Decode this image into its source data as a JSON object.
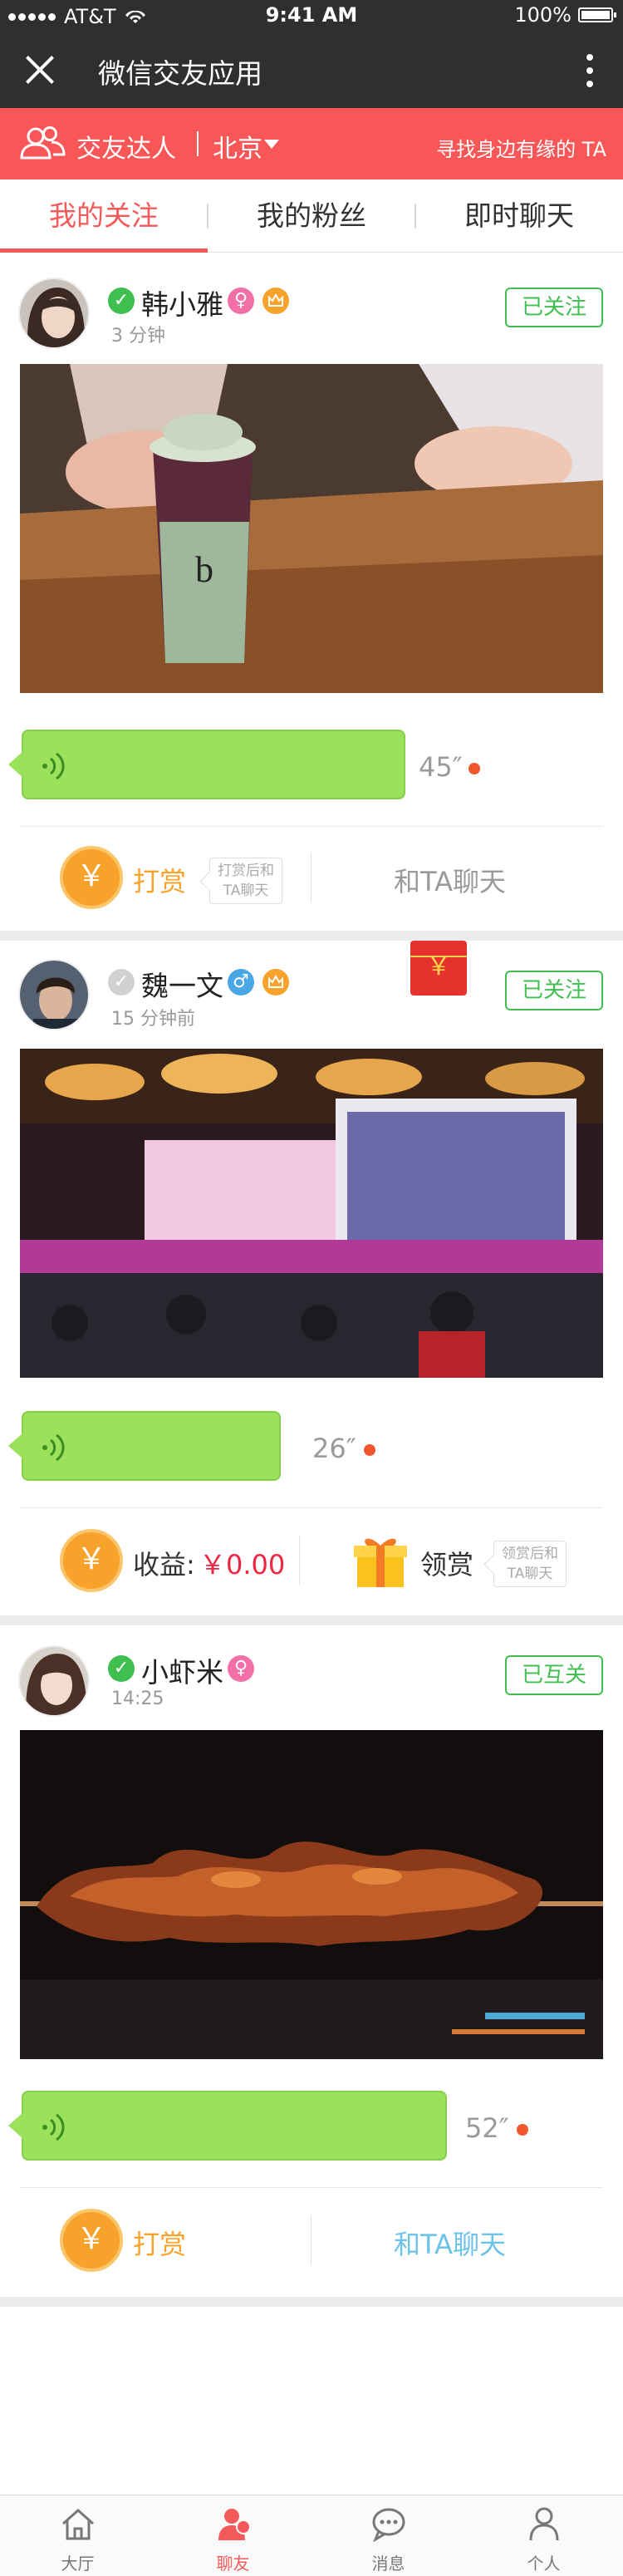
{
  "status_bar": {
    "carrier": "AT&T",
    "time": "9:41 AM",
    "battery": "100%"
  },
  "nav": {
    "title": "微信交友应用"
  },
  "banner": {
    "category": "交友达人",
    "city": "北京",
    "hint": "寻找身边有缘的 TA"
  },
  "tabs": [
    {
      "label": "我的关注"
    },
    {
      "label": "我的粉丝"
    },
    {
      "label": "即时聊天"
    }
  ],
  "posts": [
    {
      "name": "韩小雅",
      "time": "3 分钟",
      "follow_label": "已关注",
      "voice_duration": "45″",
      "reward_label": "打赏",
      "reward_hint": [
        "打赏后和",
        "TA聊天"
      ],
      "chat_label": "和TA聊天"
    },
    {
      "name": "魏一文",
      "time": "15 分钟前",
      "follow_label": "已关注",
      "voice_duration": "26″",
      "income_label": "收益:",
      "income_value": "￥0.00",
      "claim_label": "领赏",
      "claim_hint": [
        "领赏后和",
        "TA聊天"
      ],
      "redpacket_symbol": "￥",
      "coin_symbol": "￥"
    },
    {
      "name": "小虾米",
      "time": "14:25",
      "follow_label": "已互关",
      "voice_duration": "52″",
      "reward_label": "打赏",
      "chat_label": "和TA聊天"
    }
  ],
  "tabbar": [
    {
      "label": "大厅",
      "icon": "home-icon"
    },
    {
      "label": "聊友",
      "icon": "user-chat-icon"
    },
    {
      "label": "消息",
      "icon": "message-icon"
    },
    {
      "label": "个人",
      "icon": "profile-icon"
    }
  ],
  "colors": {
    "accent": "#f95757",
    "follow_green": "#3fbf50",
    "voice_green": "#9be15b",
    "coin": "#f7a22b"
  }
}
